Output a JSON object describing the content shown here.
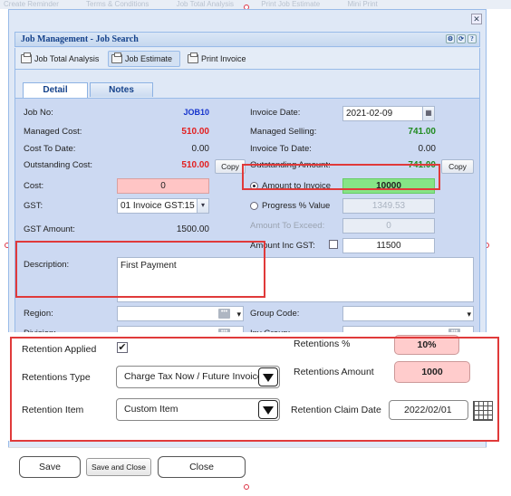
{
  "background_strip": [
    "Create Reminder",
    "Terms & Conditions",
    "Job Total Analysis",
    "Print Job Estimate",
    "Mini Print"
  ],
  "panel": {
    "title": "Job Management - Job Search"
  },
  "toolbar": {
    "job_total_analysis": "Job Total Analysis",
    "job_estimate": "Job Estimate",
    "print_invoice": "Print Invoice"
  },
  "tabs": {
    "detail": "Detail",
    "notes": "Notes"
  },
  "left": {
    "job_no_label": "Job No:",
    "job_no_value": "JOB10",
    "managed_cost_label": "Managed Cost:",
    "managed_cost_value": "510.00",
    "cost_to_date_label": "Cost To Date:",
    "cost_to_date_value": "0.00",
    "outstanding_cost_label": "Outstanding Cost:",
    "outstanding_cost_value": "510.00",
    "copy_label": "Copy",
    "cost_label": "Cost:",
    "cost_value": "0",
    "gst_label": "GST:",
    "gst_value": "01 Invoice GST:15",
    "gst_amount_label": "GST Amount:",
    "gst_amount_value": "1500.00",
    "description_label": "Description:",
    "description_value": "First Payment",
    "region_label": "Region:",
    "division_label": "Division:"
  },
  "right": {
    "invoice_date_label": "Invoice Date:",
    "invoice_date_value": "2021-02-09",
    "managed_selling_label": "Managed Selling:",
    "managed_selling_value": "741.00",
    "invoice_to_date_label": "Invoice To Date:",
    "invoice_to_date_value": "0.00",
    "outstanding_amount_label": "Outstanding Amount:",
    "outstanding_amount_value": "741.00",
    "copy_label": "Copy",
    "amount_to_invoice_label": "Amount to Invoice",
    "amount_to_invoice_value": "10000",
    "progress_value_label": "Progress % Value",
    "progress_value_value": "1349.53",
    "amount_to_exceed_label": "Amount To Exceed:",
    "amount_to_exceed_value": "0",
    "amount_inc_gst_label": "Amount Inc GST:",
    "amount_inc_gst_value": "11500",
    "group_code_label": "Group Code:",
    "inv_group_label": "Inv Group:"
  },
  "retention": {
    "applied_label": "Retention Applied",
    "applied_checked": true,
    "percent_label": "Retentions %",
    "percent_value": "10%",
    "type_label": "Retentions Type",
    "type_value": "Charge Tax Now / Future Invoice",
    "amount_label": "Retentions Amount",
    "amount_value": "1000",
    "item_label": "Retention Item",
    "item_value": "Custom Item",
    "claim_date_label": "Retention Claim Date",
    "claim_date_value": "2022/02/01"
  },
  "buttons": {
    "save": "Save",
    "save_and_close": "Save and Close",
    "close": "Close"
  },
  "colors": {
    "highlight": "#e03a3a",
    "panel": "#ccd9f2",
    "accent": "#15428b"
  }
}
